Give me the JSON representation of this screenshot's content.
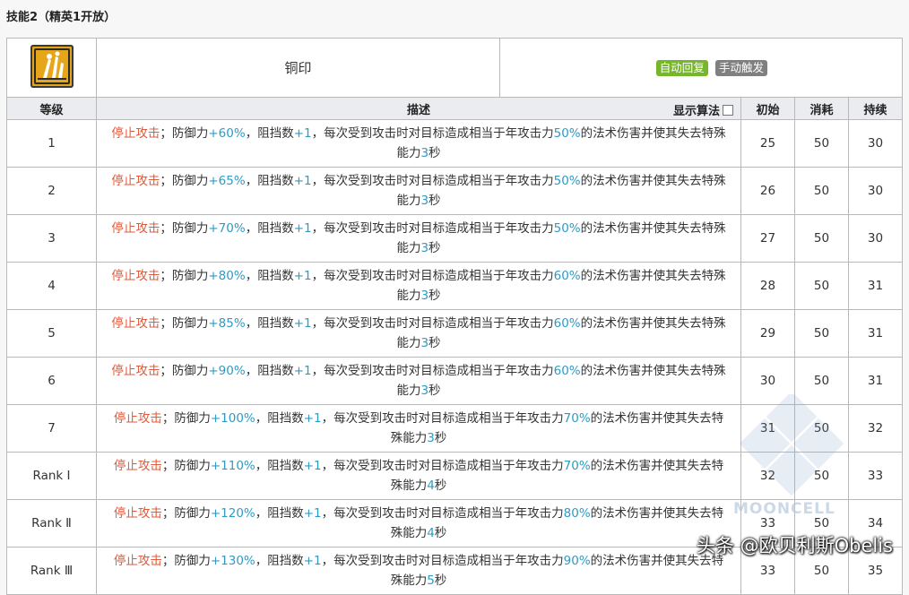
{
  "section_title": "技能2（精英1开放）",
  "skill": {
    "icon": "skill-icon",
    "name": "铜印",
    "tags": [
      "自动回复",
      "手动触发"
    ]
  },
  "columns": {
    "level": "等级",
    "desc": "描述",
    "algo": "显示算法",
    "init": "初始",
    "cost": "消耗",
    "duration": "持续"
  },
  "rows": [
    {
      "level": "1",
      "defense": "+60%",
      "pct": "50%",
      "secs": "3",
      "init": "25",
      "cost": "50",
      "dur": "30",
      "br": 1
    },
    {
      "level": "2",
      "defense": "+65%",
      "pct": "50%",
      "secs": "3",
      "init": "26",
      "cost": "50",
      "dur": "30",
      "br": 1
    },
    {
      "level": "3",
      "defense": "+70%",
      "pct": "50%",
      "secs": "3",
      "init": "27",
      "cost": "50",
      "dur": "30",
      "br": 1
    },
    {
      "level": "4",
      "defense": "+80%",
      "pct": "60%",
      "secs": "3",
      "init": "28",
      "cost": "50",
      "dur": "31",
      "br": 1
    },
    {
      "level": "5",
      "defense": "+85%",
      "pct": "60%",
      "secs": "3",
      "init": "29",
      "cost": "50",
      "dur": "31",
      "br": 1
    },
    {
      "level": "6",
      "defense": "+90%",
      "pct": "60%",
      "secs": "3",
      "init": "30",
      "cost": "50",
      "dur": "31",
      "br": 1
    },
    {
      "level": "7",
      "defense": "+100%",
      "pct": "70%",
      "secs": "3",
      "init": "31",
      "cost": "50",
      "dur": "32",
      "br": 2
    },
    {
      "level": "Rank Ⅰ",
      "defense": "+110%",
      "pct": "70%",
      "secs": "4",
      "init": "32",
      "cost": "50",
      "dur": "33",
      "br": 2
    },
    {
      "level": "Rank Ⅱ",
      "defense": "+120%",
      "pct": "80%",
      "secs": "4",
      "init": "33",
      "cost": "50",
      "dur": "34",
      "br": 2
    },
    {
      "level": "Rank Ⅲ",
      "defense": "+130%",
      "pct": "90%",
      "secs": "5",
      "init": "33",
      "cost": "50",
      "dur": "35",
      "br": 2
    }
  ],
  "desc_parts": {
    "stop": "停止攻击",
    "semi": "；防御力",
    "block": "，阻挡数",
    "plus1": "+1",
    "mid": "，每次受到攻击时对目标造成相当于年攻击力",
    "tail_a": "的法术伤害并使其失去特殊",
    "tail_b": "能力",
    "tail_a2": "的法术伤害并使其失去特",
    "tail_b2": "殊能力",
    "sec": "秒"
  },
  "watermark_text": "MOONCELL",
  "credit": "头条 @欧贝利斯Obelis"
}
